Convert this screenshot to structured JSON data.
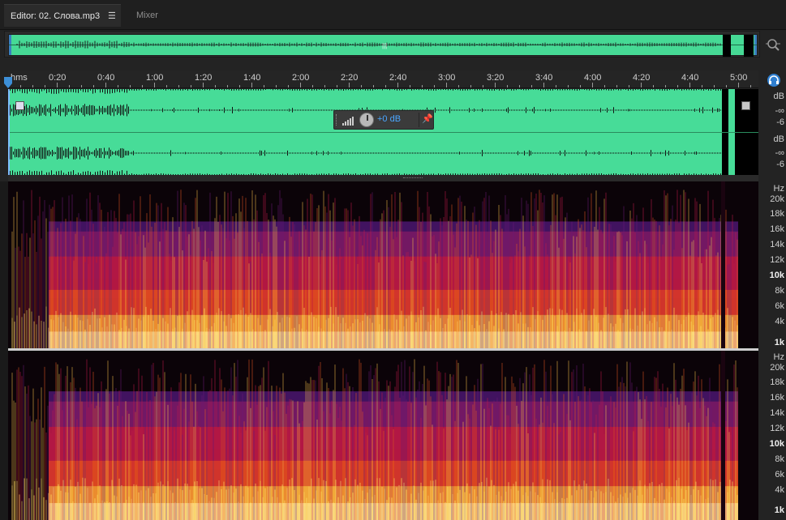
{
  "tabs": {
    "editor_label": "Editor: 02. Слова.mp3",
    "mixer_label": "Mixer"
  },
  "ruler": {
    "unit_label": "hms",
    "labels": [
      "0:20",
      "0:40",
      "1:00",
      "1:20",
      "1:40",
      "2:00",
      "2:20",
      "2:40",
      "3:00",
      "3:20",
      "3:40",
      "4:00",
      "4:20",
      "4:40",
      "5:00"
    ]
  },
  "hud": {
    "volume_value": "+0 dB"
  },
  "amplitude_scale": {
    "top": [
      "dB",
      "-∞",
      "-6"
    ],
    "bottom": [
      "dB",
      "-∞",
      "-6"
    ]
  },
  "frequency_scale": {
    "top": [
      "Hz",
      "20k",
      "18k",
      "16k",
      "14k",
      "12k",
      "10k",
      "8k",
      "6k",
      "4k",
      "1k"
    ],
    "bottom": [
      "Hz",
      "20k",
      "18k",
      "16k",
      "14k",
      "12k",
      "10k",
      "8k",
      "6k",
      "4k",
      "1k"
    ],
    "bold_labels": [
      "10k",
      "1k"
    ]
  },
  "icons": {
    "tab_menu": "hamburger-menu-icon",
    "zoom": "zoom-full-icon",
    "monitor": "headphones-monitor-icon",
    "volume": "volume-bars-icon",
    "pin": "pin-icon"
  },
  "colors": {
    "waveform": "#47dc98",
    "accent": "#4aa7ff",
    "spectral_hot": "#ffd24a",
    "spectral_mid": "#d6173a",
    "spectral_low": "#5a1a78"
  }
}
